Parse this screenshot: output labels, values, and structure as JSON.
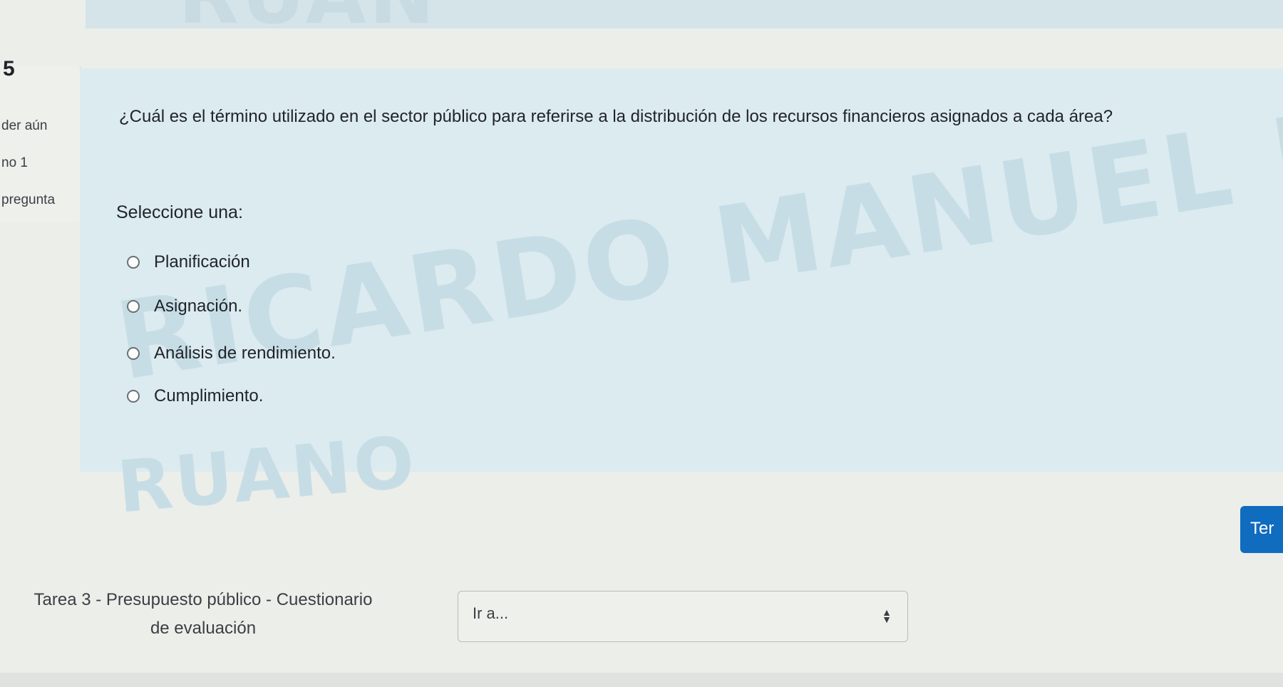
{
  "question": {
    "number": "5",
    "info": [
      "der aún",
      "no 1",
      "pregunta"
    ],
    "text": "¿Cuál es el término utilizado en el sector público para referirse a la distribución de los recursos financieros asignados a cada área?",
    "prompt": "Seleccione una:",
    "answers": [
      "Planificación",
      "Asignación.",
      "Análisis de rendimiento.",
      "Cumplimiento."
    ]
  },
  "watermark": {
    "line1": "RICARDO MANUEL IMBACUAN",
    "line2": "RUANO",
    "top_fragment": "RUAN"
  },
  "finish_button": {
    "label": "Ter"
  },
  "navigation": {
    "previous_line1": "Tarea 3 -  Presupuesto público - Cuestionario",
    "previous_line2": "de evaluación",
    "jump_placeholder": "Ir a..."
  },
  "colors": {
    "accent": "#0f6cbf",
    "formulation_bg": "#dcebf0",
    "watermark": "#c7dde6"
  },
  "icons": {
    "radio": "radio-unchecked-icon",
    "select": "select-arrows-icon"
  }
}
